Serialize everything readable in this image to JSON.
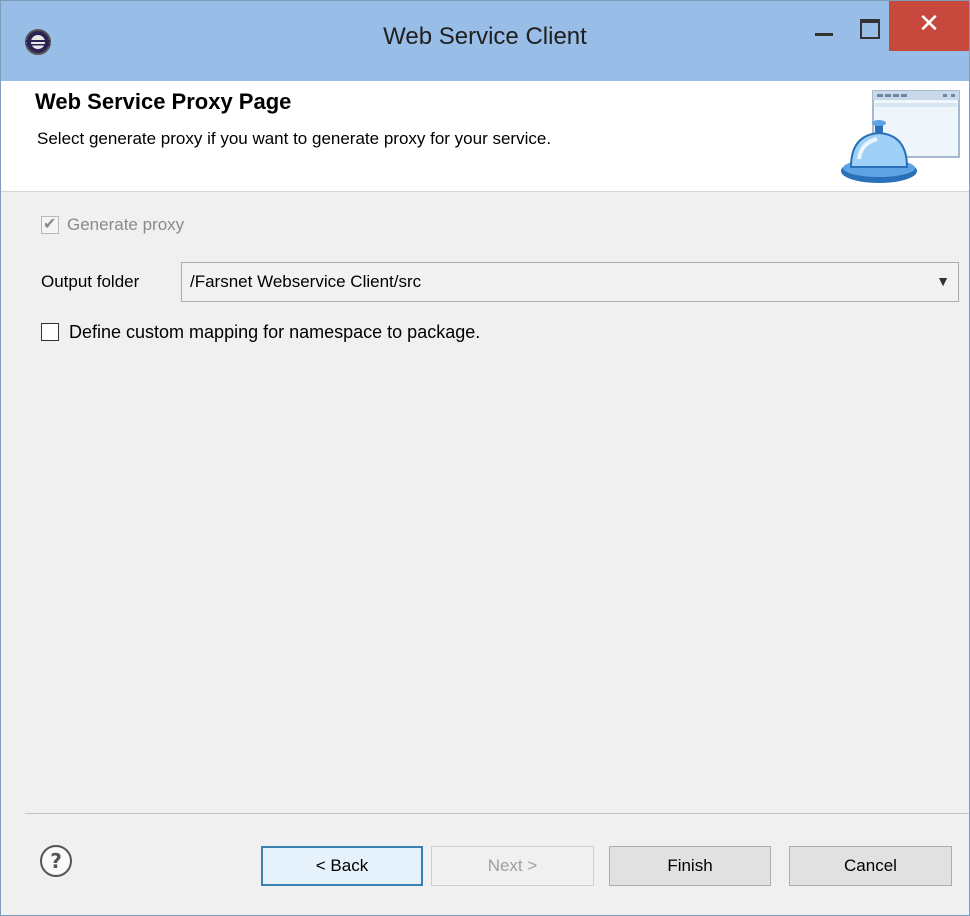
{
  "window": {
    "title": "Web Service Client",
    "app_icon": "eclipse-icon",
    "close_glyph": "✕"
  },
  "banner": {
    "title": "Web Service Proxy Page",
    "description": "Select generate proxy if you want to generate proxy for your service.",
    "icon": "service-bell-window-icon"
  },
  "form": {
    "generate_proxy": {
      "label": "Generate proxy",
      "checked": true,
      "disabled": true
    },
    "output_folder": {
      "label": "Output folder",
      "value": "/Farsnet Webservice Client/src"
    },
    "custom_mapping": {
      "label": "Define custom mapping for namespace to package.",
      "checked": false
    }
  },
  "buttons": {
    "help_icon": "help-question-icon",
    "back": "< Back",
    "next": "Next >",
    "finish": "Finish",
    "cancel": "Cancel"
  },
  "colors": {
    "titlebar": "#98bde6",
    "close_button": "#c7483c",
    "default_button_border": "#3c7fb1"
  }
}
